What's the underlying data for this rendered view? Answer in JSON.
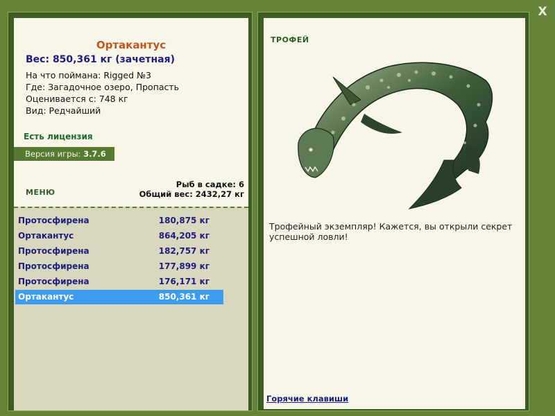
{
  "window": {
    "close_label": "X"
  },
  "fish": {
    "name": "Ортакантус",
    "weight_line": "Вес: 850,361 кг (зачетная)",
    "caught_with": "На что поймана: Rigged №3",
    "location": "Где: Загадочное озеро, Пропасть",
    "valued_from": "Оценивается с: 748 кг",
    "rarity": "Вид: Редчайший"
  },
  "license": "Есть лицензия",
  "version": {
    "label": "Версия игры:",
    "value": "3.7.6"
  },
  "menu_label": "МЕНЮ",
  "summary": {
    "fish_count": "Рыб в садке: 6",
    "total_weight": "Общий вес: 2432,27 кг"
  },
  "catch_list": [
    {
      "name": "Протосфирена",
      "weight": "180,875 кг"
    },
    {
      "name": "Ортакантус",
      "weight": "864,205 кг"
    },
    {
      "name": "Протосфирена",
      "weight": "182,757 кг"
    },
    {
      "name": "Протосфирена",
      "weight": "177,899 кг"
    },
    {
      "name": "Протосфирена",
      "weight": "176,171 кг"
    },
    {
      "name": "Ортакантус",
      "weight": "850,361 кг",
      "selected": true
    }
  ],
  "trophy": {
    "label": "ТРОФЕЙ",
    "message": "Трофейный экземпляр! Кажется, вы открыли секрет успешной ловли!"
  },
  "hotkeys_label": "Горячие клавиши",
  "colors": {
    "background": "#64843a",
    "panel": "#f7f6e9",
    "list_bg": "#d9d7bd",
    "selected_row": "#3e9cf0",
    "title": "#c4541c",
    "link": "#1d1d80",
    "accent_green": "#2f5e26"
  }
}
